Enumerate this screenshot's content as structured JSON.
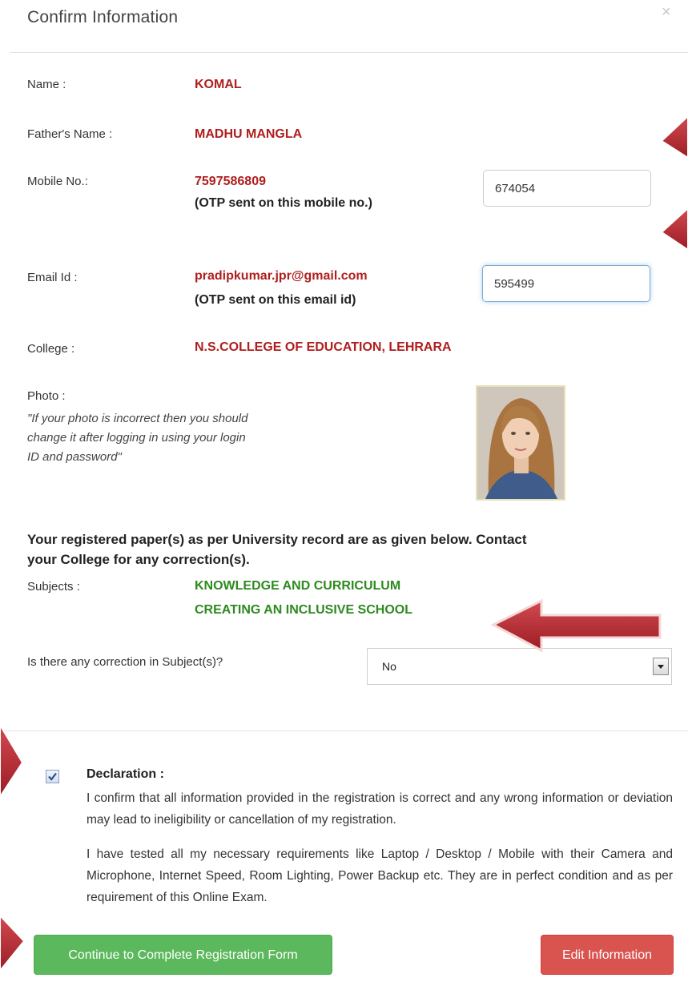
{
  "modal": {
    "title": "Confirm Information",
    "close_glyph": "×"
  },
  "fields": {
    "name_label": "Name :",
    "name_value": "KOMAL",
    "father_label": "Father's Name :",
    "father_value": "MADHU MANGLA",
    "mobile_label": "Mobile No.:",
    "mobile_value": "7597586809",
    "mobile_note": "(OTP sent on this mobile no.)",
    "mobile_otp": "674054",
    "email_label": "Email Id :",
    "email_value": "pradipkumar.jpr@gmail.com",
    "email_note": "(OTP sent on this email id)",
    "email_otp": "595499",
    "college_label": "College :",
    "college_value": "N.S.COLLEGE OF EDUCATION, LEHRARA",
    "photo_label": "Photo :",
    "photo_note_1": "\"If your photo is incorrect then you should",
    "photo_note_2": "change it after logging in using your login",
    "photo_note_3": "ID and password\""
  },
  "subjects": {
    "heading_1": "Your registered paper(s) as per University record are as given below. Contact",
    "heading_2": "your College for any correction(s).",
    "label": "Subjects :",
    "items": [
      "KNOWLEDGE AND CURRICULUM",
      "CREATING AN INCLUSIVE SCHOOL"
    ],
    "correction_question": "Is there any correction in Subject(s)?",
    "correction_selected": "No"
  },
  "declaration": {
    "checked": true,
    "title": "Declaration :",
    "para1": "I confirm that all information provided in the registration is correct and any wrong information or deviation may lead to ineligibility or cancellation of my registration.",
    "para2": "I have tested all my necessary requirements like Laptop / Desktop / Mobile with their Camera and Microphone, Internet Speed, Room Lighting, Power Backup etc. They are in perfect condition and as per requirement of this Online Exam."
  },
  "buttons": {
    "continue_label": "Continue to Complete Registration Form",
    "edit_label": "Edit Information"
  },
  "colors": {
    "value_red": "#b01e1e",
    "subject_green": "#2c8a1e",
    "continue_green": "#5cb85c",
    "edit_red": "#d9534f",
    "annotation_arrow": "#b8262f"
  },
  "icons": [
    "close-icon",
    "checkbox-checked-icon",
    "dropdown-arrow-icon",
    "annotation-arrow-icon"
  ]
}
